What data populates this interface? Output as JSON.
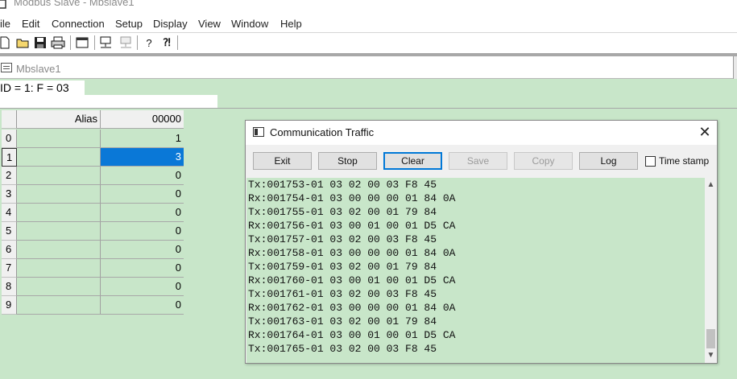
{
  "app": {
    "title": "Modbus Slave - Mbslave1"
  },
  "menu": [
    "ile",
    "Edit",
    "Connection",
    "Setup",
    "Display",
    "View",
    "Window",
    "Help"
  ],
  "toolbar": {
    "icons": [
      "new-document-icon",
      "open-folder-icon",
      "save-icon",
      "print-icon",
      "window-icon",
      "connect-icon",
      "disconnect-icon",
      "help-icon",
      "context-help-icon"
    ]
  },
  "child": {
    "title": "Mbslave1",
    "id_line": "ID = 1: F = 03"
  },
  "grid": {
    "headers": {
      "alias": "Alias",
      "value": "00000"
    },
    "rows": [
      {
        "n": "0",
        "value": "1"
      },
      {
        "n": "1",
        "value": "3"
      },
      {
        "n": "2",
        "value": "0"
      },
      {
        "n": "3",
        "value": "0"
      },
      {
        "n": "4",
        "value": "0"
      },
      {
        "n": "5",
        "value": "0"
      },
      {
        "n": "6",
        "value": "0"
      },
      {
        "n": "7",
        "value": "0"
      },
      {
        "n": "8",
        "value": "0"
      },
      {
        "n": "9",
        "value": "0"
      }
    ],
    "selected_row": 1
  },
  "traffic": {
    "title": "Communication Traffic",
    "buttons": {
      "exit": "Exit",
      "stop": "Stop",
      "clear": "Clear",
      "save": "Save",
      "copy": "Copy",
      "log": "Log"
    },
    "timestamp_label": "Time stamp",
    "timestamp_checked": false,
    "lines": [
      "Tx:001753-01 03 02 00 03 F8 45",
      "Rx:001754-01 03 00 00 00 01 84 0A",
      "Tx:001755-01 03 02 00 01 79 84",
      "Rx:001756-01 03 00 01 00 01 D5 CA",
      "Tx:001757-01 03 02 00 03 F8 45",
      "Rx:001758-01 03 00 00 00 01 84 0A",
      "Tx:001759-01 03 02 00 01 79 84",
      "Rx:001760-01 03 00 01 00 01 D5 CA",
      "Tx:001761-01 03 02 00 03 F8 45",
      "Rx:001762-01 03 00 00 00 01 84 0A",
      "Tx:001763-01 03 02 00 01 79 84",
      "Rx:001764-01 03 00 01 00 01 D5 CA",
      "Tx:001765-01 03 02 00 03 F8 45"
    ]
  },
  "colors": {
    "grid_bg": "#c8e6c9",
    "selection": "#0a78d7",
    "default_button_border": "#0078d7"
  }
}
